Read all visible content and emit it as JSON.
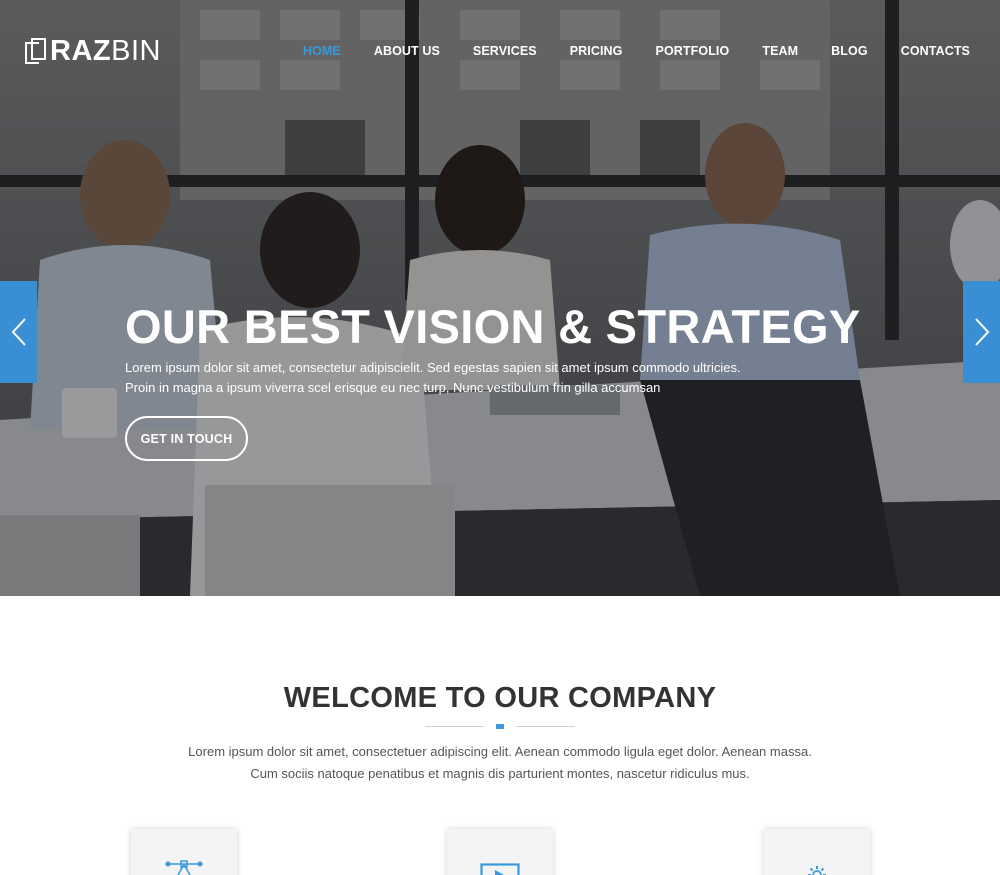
{
  "brand": {
    "bold": "RAZ",
    "light": "BIN"
  },
  "nav": {
    "items": [
      {
        "label": "HOME",
        "active": true
      },
      {
        "label": "ABOUT US",
        "active": false
      },
      {
        "label": "SERVICES",
        "active": false
      },
      {
        "label": "PRICING",
        "active": false
      },
      {
        "label": "PORTFOLIO",
        "active": false
      },
      {
        "label": "TEAM",
        "active": false
      },
      {
        "label": "BLOG",
        "active": false
      },
      {
        "label": "CONTACTS",
        "active": false
      }
    ]
  },
  "hero": {
    "title": "OUR BEST VISION & STRATEGY",
    "line1": "Lorem ipsum dolor sit amet, consectetur adipiscielit. Sed egestas sapien sit amet ipsum commodo ultricies.",
    "line2": "Proin in magna a ipsum viverra scel erisque eu nec turp, Nunc vestibulum frin gilla accumsan",
    "button": "GET IN TOUCH",
    "prev_icon": "chevron-left-icon",
    "next_icon": "chevron-right-icon"
  },
  "welcome": {
    "title": "WELCOME TO OUR COMPANY",
    "line1": "Lorem ipsum dolor sit amet, consectetuer adipiscing elit. Aenean commodo ligula eget dolor. Aenean massa.",
    "line2": "Cum sociis natoque penatibus et magnis dis parturient montes, nascetur ridiculus mus."
  },
  "features": [
    {
      "icon": "vector-pen-icon"
    },
    {
      "icon": "monitor-icon"
    },
    {
      "icon": "gear-icon"
    }
  ],
  "colors": {
    "accent": "#3a9ad9",
    "arrow_bg": "#3a8fd4",
    "heading": "#333333",
    "body_text": "#555555"
  }
}
